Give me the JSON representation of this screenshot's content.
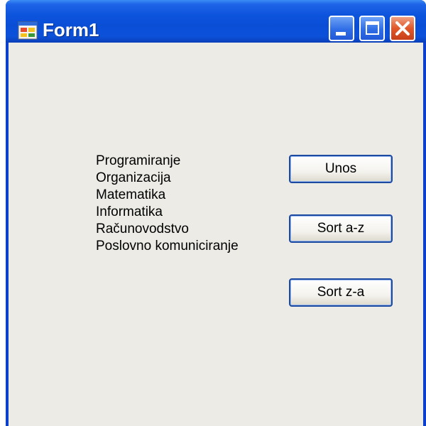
{
  "window": {
    "title": "Form1",
    "icon": "form-app-icon",
    "controls": {
      "minimize_icon": "minimize-icon",
      "maximize_icon": "maximize-icon",
      "close_icon": "close-icon"
    }
  },
  "colors": {
    "titlebar": "#0a4ed6",
    "client_background": "#ecebe6",
    "close_button": "#e0582a",
    "button_border": "#1b4aa0"
  },
  "subjects": [
    "Programiranje",
    "Organizacija",
    "Matematika",
    "Informatika",
    "Računovodstvo",
    "Poslovno komuniciranje"
  ],
  "buttons": {
    "unos": "Unos",
    "sort_az": "Sort a-z",
    "sort_za": "Sort z-a"
  }
}
